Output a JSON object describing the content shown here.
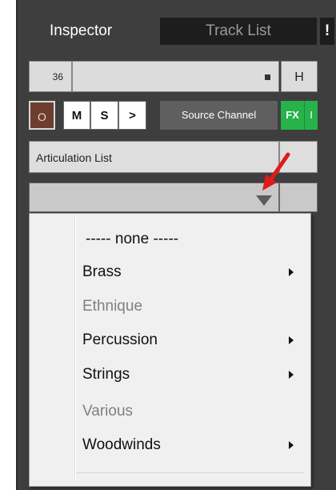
{
  "tabs": {
    "inspector": "Inspector",
    "track_list": "Track List",
    "bang": "!"
  },
  "track": {
    "number": "36",
    "h_label": "H"
  },
  "controls": {
    "o_label": "O",
    "m_label": "M",
    "s_label": "S",
    "gt_label": ">",
    "source_channel": "Source Channel",
    "fx_label": "FX",
    "i_label": "I"
  },
  "articulation": {
    "label": "Articulation List"
  },
  "menu": {
    "none_label": "----- none -----",
    "items": [
      {
        "label": "Brass",
        "enabled": true,
        "submenu": true
      },
      {
        "label": "Ethnique",
        "enabled": false,
        "submenu": false
      },
      {
        "label": "Percussion",
        "enabled": true,
        "submenu": true
      },
      {
        "label": "Strings",
        "enabled": true,
        "submenu": true
      },
      {
        "label": "Various",
        "enabled": false,
        "submenu": false
      },
      {
        "label": "Woodwinds",
        "enabled": true,
        "submenu": true
      }
    ]
  },
  "colors": {
    "panel_bg": "#3e3e3e",
    "fx_green": "#27b24a",
    "o_button": "#6d3d30",
    "annotation_red": "#e11a1a"
  }
}
